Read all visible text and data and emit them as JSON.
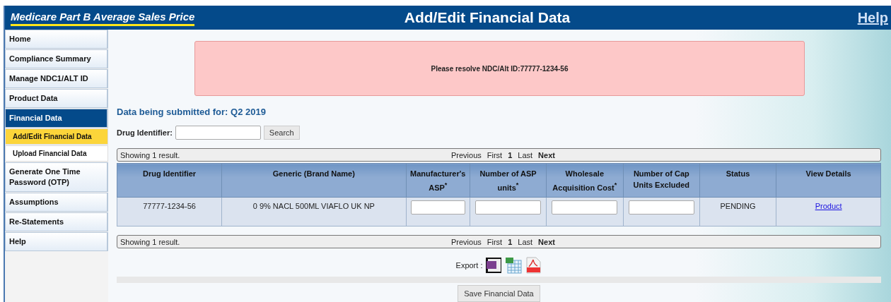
{
  "header": {
    "brand": "Medicare Part B Average Sales Price",
    "title": "Add/Edit Financial Data",
    "help": "Help"
  },
  "sidebar": {
    "items": [
      {
        "label": "Home",
        "selected": false
      },
      {
        "label": "Compliance Summary",
        "selected": false
      },
      {
        "label": "Manage NDC1/ALT ID",
        "selected": false
      },
      {
        "label": "Product Data",
        "selected": false
      },
      {
        "label": "Financial Data",
        "selected": true,
        "children": [
          {
            "label": "Add/Edit Financial Data",
            "selected": true
          },
          {
            "label": "Upload Financial Data",
            "selected": false
          }
        ]
      },
      {
        "label": "Generate One Time Password (OTP)",
        "selected": false
      },
      {
        "label": "Assumptions",
        "selected": false
      },
      {
        "label": "Re-Statements",
        "selected": false
      },
      {
        "label": "Help",
        "selected": false
      }
    ]
  },
  "alert": {
    "message": "Please resolve NDC/Alt ID:77777-1234-56"
  },
  "submission": {
    "heading": "Data being submitted for: Q2 2019"
  },
  "search": {
    "label": "Drug Identifier:",
    "button": "Search"
  },
  "pager_top": {
    "summary": "Showing 1 result.",
    "links": [
      {
        "label": "Previous",
        "active": false
      },
      {
        "label": "First",
        "active": false
      },
      {
        "label": "1",
        "active": true
      },
      {
        "label": "Last",
        "active": false
      },
      {
        "label": "Next",
        "active": true
      }
    ]
  },
  "table": {
    "columns": [
      "Drug Identifier",
      "Generic (Brand Name)",
      "Manufacturer's ASP$^{*}$",
      "Number of ASP units$^{*}$",
      "Wholesale Acquisition Cost$^{*}$",
      "Number of Cap Units Excluded",
      "Status",
      "View Details"
    ],
    "rows": [
      {
        "cells": [
          {
            "kind": "text",
            "text": "77777-1234-56"
          },
          {
            "kind": "text",
            "text": "0 9% NACL 500ML VIAFLO UK NP"
          },
          {
            "kind": "input"
          },
          {
            "kind": "input"
          },
          {
            "kind": "input"
          },
          {
            "kind": "input"
          },
          {
            "kind": "text",
            "text": "PENDING"
          },
          {
            "kind": "link",
            "text": "Product"
          }
        ]
      }
    ]
  },
  "pager_bottom": {
    "summary": "Showing 1 result.",
    "links": [
      {
        "label": "Previous",
        "active": false
      },
      {
        "label": "First",
        "active": false
      },
      {
        "label": "1",
        "active": true
      },
      {
        "label": "Last",
        "active": false
      },
      {
        "label": "Next",
        "active": true
      }
    ]
  },
  "export": {
    "label": "Export :",
    "formats": [
      {
        "kind": "csv"
      },
      {
        "kind": "excel"
      },
      {
        "kind": "pdf"
      }
    ]
  },
  "save_button": "Save Financial Data"
}
